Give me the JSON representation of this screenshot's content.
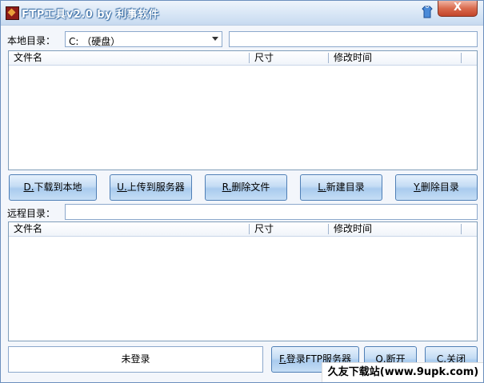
{
  "window": {
    "title": "FTP工具v2.0  by 利事软件",
    "close_label": "X"
  },
  "local": {
    "label": "本地目录：",
    "drive_value": "C: （硬盘）",
    "path_value": "",
    "columns": [
      "文件名",
      "尺寸",
      "修改时间"
    ]
  },
  "local_actions": {
    "download": {
      "key": "D.",
      "label": "下载到本地"
    },
    "upload": {
      "key": "U.",
      "label": "上传到服务器"
    },
    "delete_file": {
      "key": "R.",
      "label": "删除文件"
    },
    "new_dir": {
      "key": "L.",
      "label": "新建目录"
    },
    "delete_dir": {
      "key": "Y.",
      "label": "删除目录"
    }
  },
  "remote": {
    "label": "远程目录：",
    "path_value": "",
    "columns": [
      "文件名",
      "尺寸",
      "修改时间"
    ]
  },
  "status": {
    "text": "未登录"
  },
  "bottom_actions": {
    "login": {
      "key": "F.",
      "label": "登录FTP服务器"
    },
    "disconnect": {
      "key": "Q.",
      "label": "断开"
    },
    "close": {
      "key": "C.",
      "label": "关闭"
    }
  },
  "watermark": {
    "text": "久友下载站(www.9upk.com)"
  },
  "icons": {
    "app": "app-icon",
    "skin": "clothing-icon"
  }
}
